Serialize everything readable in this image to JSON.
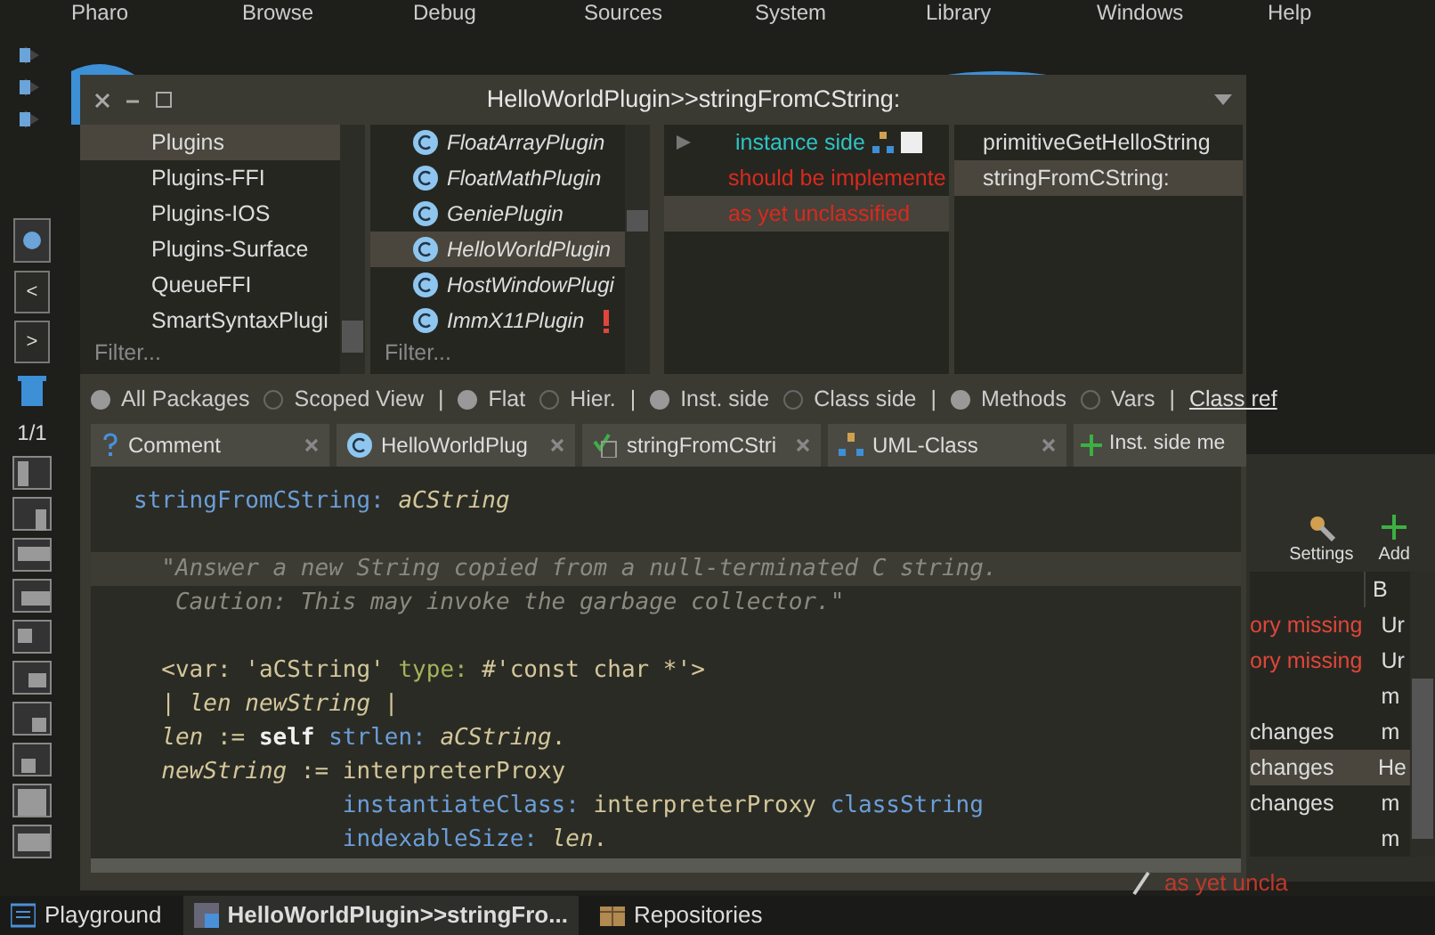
{
  "menu_bar": [
    "Pharo",
    "Browse",
    "Debug",
    "Sources",
    "System",
    "Library",
    "Windows",
    "Help"
  ],
  "dock": {
    "prev": "<",
    "next": ">",
    "page": "1/1"
  },
  "browser": {
    "title": "HelloWorldPlugin>>stringFromCString:",
    "packages": {
      "placeholder": "Filter...",
      "items": [
        {
          "label": "Plugins",
          "selected": true
        },
        {
          "label": "Plugins-FFI",
          "selected": false
        },
        {
          "label": "Plugins-IOS",
          "selected": false
        },
        {
          "label": "Plugins-Surface",
          "selected": false
        },
        {
          "label": "QueueFFI",
          "selected": false
        },
        {
          "label": "SmartSyntaxPlugi",
          "selected": false
        }
      ]
    },
    "classes": {
      "placeholder": "Filter...",
      "items": [
        {
          "label": "FloatArrayPlugin",
          "selected": false,
          "warning": false
        },
        {
          "label": "FloatMathPlugin",
          "selected": false,
          "warning": false
        },
        {
          "label": "GeniePlugin",
          "selected": false,
          "warning": false
        },
        {
          "label": "HelloWorldPlugin",
          "selected": true,
          "warning": false
        },
        {
          "label": "HostWindowPlugi",
          "selected": false,
          "warning": false
        },
        {
          "label": "ImmX11Plugin",
          "selected": false,
          "warning": true
        }
      ]
    },
    "protocols": [
      {
        "label": "instance side",
        "kind": "side",
        "selected": false
      },
      {
        "label": "should be implemente",
        "kind": "protocol",
        "selected": false
      },
      {
        "label": "as yet unclassified",
        "kind": "protocol",
        "selected": true
      }
    ],
    "methods": [
      {
        "label": "primitiveGetHelloString",
        "selected": false
      },
      {
        "label": "stringFromCString:",
        "selected": true
      }
    ],
    "options": [
      {
        "items": [
          {
            "label": "All Packages",
            "selected": true
          },
          {
            "label": "Scoped View",
            "selected": false
          }
        ],
        "separator": "|"
      },
      {
        "items": [
          {
            "label": "Flat",
            "selected": true
          },
          {
            "label": "Hier.",
            "selected": false
          }
        ],
        "separator": "|"
      },
      {
        "items": [
          {
            "label": "Inst. side",
            "selected": true
          },
          {
            "label": "Class side",
            "selected": false
          }
        ],
        "separator": "|"
      },
      {
        "items": [
          {
            "label": "Methods",
            "selected": true
          },
          {
            "label": "Vars",
            "selected": false
          }
        ],
        "separator": "|"
      }
    ],
    "class_refs_link": "Class ref",
    "tabs": [
      {
        "label": "Comment",
        "closable": true
      },
      {
        "label": "HelloWorldPlug",
        "closable": true
      },
      {
        "label": "stringFromCStri",
        "closable": true
      },
      {
        "label": "UML-Class",
        "closable": true
      },
      {
        "label": "Inst. side me",
        "closable": false
      }
    ],
    "code": [
      [
        {
          "selected": false,
          "tokens": [
            {
              "t": "stringFromCString: ",
              "kind": "sel"
            },
            {
              "t": "aCString",
              "kind": "arg"
            }
          ]
        }
      ],
      [
        {
          "selected": true,
          "tokens": [
            {
              "t": "  \"Answer a new String copied from a null-terminated C string.",
              "kind": "comment"
            }
          ]
        },
        {
          "selected": false,
          "tokens": [
            {
              "t": "   Caution: This may invoke the garbage collector.\"",
              "kind": "comment"
            }
          ]
        }
      ],
      [
        {
          "selected": false,
          "tokens": [
            {
              "t": "  <var: 'aCString' ",
              "kind": "plain"
            },
            {
              "t": "type:",
              "kind": "kw"
            },
            {
              "t": " #'const char *'>",
              "kind": "plain"
            }
          ]
        },
        {
          "selected": false,
          "tokens": [
            {
              "t": "  | ",
              "kind": "plain"
            },
            {
              "t": "len newString",
              "kind": "arg"
            },
            {
              "t": " |",
              "kind": "plain"
            }
          ]
        },
        {
          "selected": false,
          "tokens": [
            {
              "t": "  len",
              "kind": "arg"
            },
            {
              "t": " := ",
              "kind": "plain"
            },
            {
              "t": "self",
              "kind": "self"
            },
            {
              "t": " strlen: ",
              "kind": "sel"
            },
            {
              "t": "aCString",
              "kind": "arg"
            },
            {
              "t": ".",
              "kind": "plain"
            }
          ]
        },
        {
          "selected": false,
          "tokens": [
            {
              "t": "  newString",
              "kind": "arg"
            },
            {
              "t": " := interpreterProxy",
              "kind": "plain"
            }
          ]
        },
        {
          "selected": false,
          "tokens": [
            {
              "t": "               instantiateClass: ",
              "kind": "sel"
            },
            {
              "t": "interpreterProxy ",
              "kind": "plain"
            },
            {
              "t": "classString",
              "kind": "sel"
            }
          ]
        },
        {
          "selected": false,
          "tokens": [
            {
              "t": "               indexableSize: ",
              "kind": "sel"
            },
            {
              "t": "len",
              "kind": "arg"
            },
            {
              "t": ".",
              "kind": "plain"
            }
          ]
        }
      ]
    ]
  },
  "repositories": {
    "toolbar": [
      "Settings",
      "Add"
    ],
    "column_2": "B",
    "rows": [
      {
        "status": "ory missing",
        "error": true,
        "branch": "Ur",
        "selected": false
      },
      {
        "status": "ory missing",
        "error": true,
        "branch": "Ur",
        "selected": false
      },
      {
        "branch": "m",
        "selected": false
      },
      {
        "status": "changes",
        "error": false,
        "branch": "m",
        "selected": false
      },
      {
        "status": "changes",
        "error": false,
        "branch": "He",
        "selected": true
      },
      {
        "status": "changes",
        "error": false,
        "branch": "m",
        "selected": false
      },
      {
        "branch": "m",
        "selected": false
      }
    ]
  },
  "drag_label": "as yet uncla",
  "taskbar": [
    {
      "label": "Playground",
      "selected": false
    },
    {
      "label": "HelloWorldPlugin>>stringFro...",
      "selected": true
    },
    {
      "label": "Repositories",
      "selected": false
    }
  ]
}
